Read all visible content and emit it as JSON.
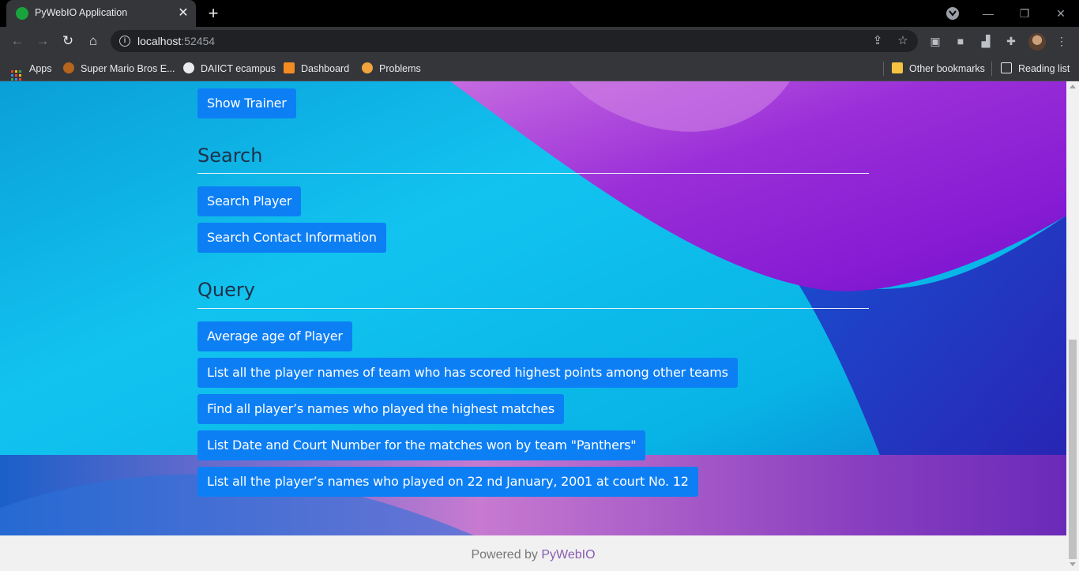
{
  "browser": {
    "tab_title": "PyWebIO Application",
    "url_host": "localhost",
    "url_port": ":52454",
    "window_controls": [
      "minimize",
      "restore",
      "close"
    ]
  },
  "bookmarks": {
    "items": [
      "Apps",
      "Super Mario Bros E...",
      "DAIICT ecampus",
      "Dashboard",
      "Problems"
    ],
    "other": "Other bookmarks",
    "reading_list": "Reading list"
  },
  "page": {
    "partial_button": "",
    "show_trainer": "Show Trainer",
    "sections": [
      {
        "heading": "Search",
        "buttons": [
          "Search Player",
          "Search Contact Information"
        ]
      },
      {
        "heading": "Query",
        "buttons": [
          "Average age of Player",
          "List all the player names of team who has scored highest points among other teams",
          "Find all player’s names who played the highest matches",
          "List Date and Court Number for the matches won by team \"Panthers\"",
          "List all the player’s names who played on 22 nd January, 2001 at court No. 12"
        ]
      }
    ],
    "footer_prefix": "Powered by ",
    "footer_link": "PyWebIO"
  },
  "colors": {
    "button": "#0d7ff5",
    "heading": "#1d3148",
    "footer_link": "#8a5bb0"
  }
}
